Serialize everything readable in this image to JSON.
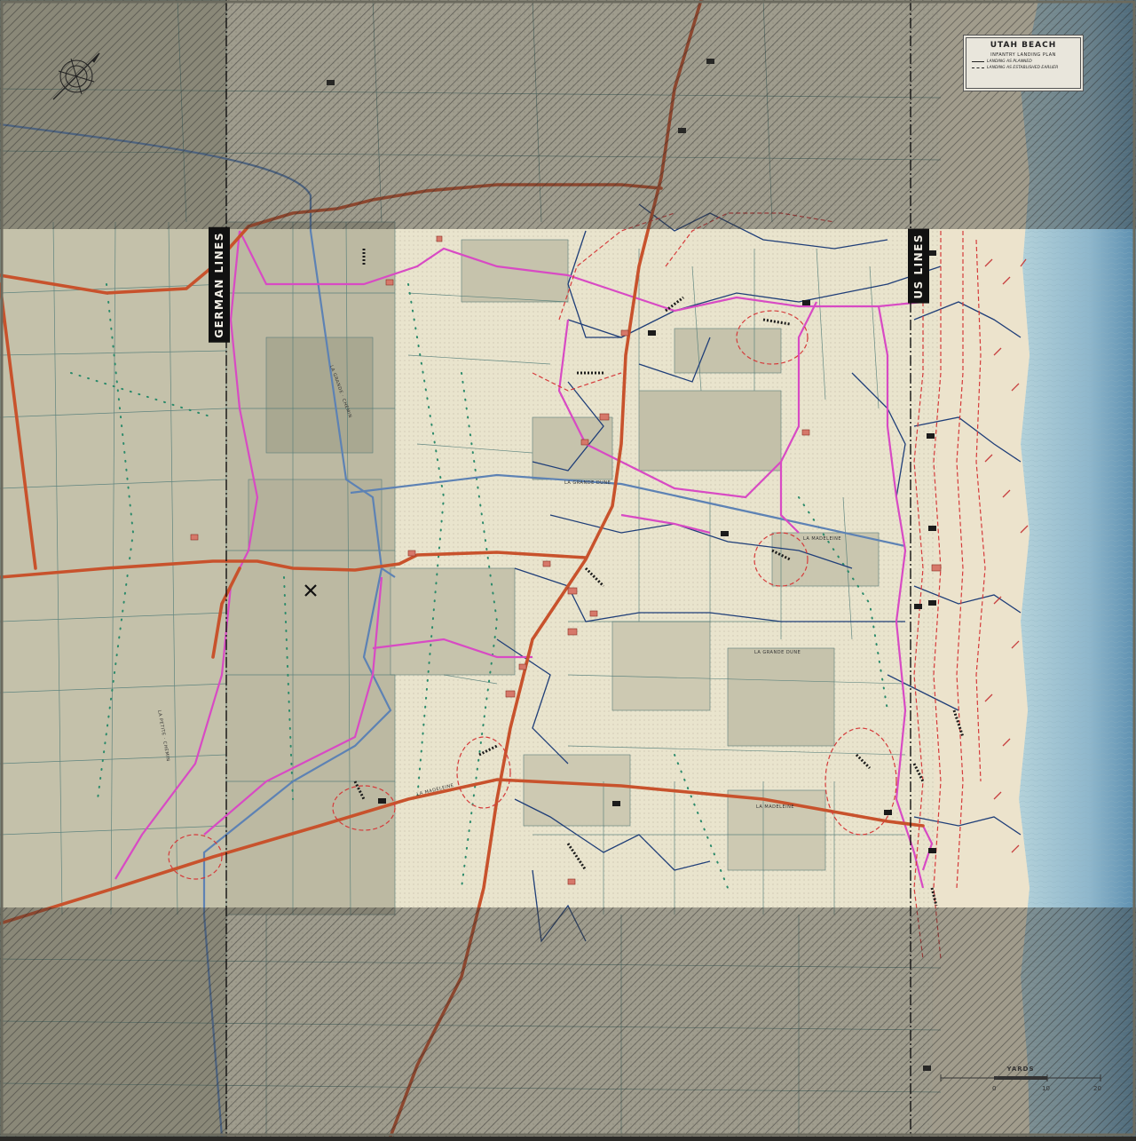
{
  "title": "UTAH BEACH",
  "legend": {
    "title": "UTAH BEACH",
    "subtitle": "INFANTRY LANDING PLAN",
    "items": [
      {
        "label": "LANDING AS PLANNED",
        "style": "solid"
      },
      {
        "label": "LANDING AS ESTABLISHED EARLIER",
        "style": "dashed"
      }
    ]
  },
  "front_lines": {
    "german": "GERMAN LINES",
    "us": "US LINES"
  },
  "road_labels": {
    "grande_dune_1": "LA GRANDE DUNE",
    "grande_dune_2": "LA GRANDE DUNE",
    "madeleine_1": "LA MADELEINE",
    "madeleine_2": "LA MADELEINE",
    "madeleine_3": "LA MADELEINE",
    "grand_chemin": "LA GRANDE · CHEMIN",
    "petite_chemin": "LA PETITE · CHEMIN"
  },
  "scale": {
    "label": "YARDS",
    "ticks": [
      "0",
      "10",
      "20"
    ]
  },
  "colors": {
    "land_light": "#ebe6cf",
    "land_field": "#c6c3ac",
    "land_dark": "#a9a891",
    "sea_light": "#b7d4dc",
    "sea_dark": "#5c8aa8",
    "main_road": "#c8522c",
    "pink_road": "#d84ac4",
    "blue_road": "#5d82b4",
    "trench": "#1f3e78",
    "wire": "#d53b3b",
    "shade": "#3a3a35"
  },
  "icons": [
    "compass-rose-icon",
    "airfield-icon",
    "bunker-icon",
    "hedgehog-icon",
    "mine-icon"
  ]
}
